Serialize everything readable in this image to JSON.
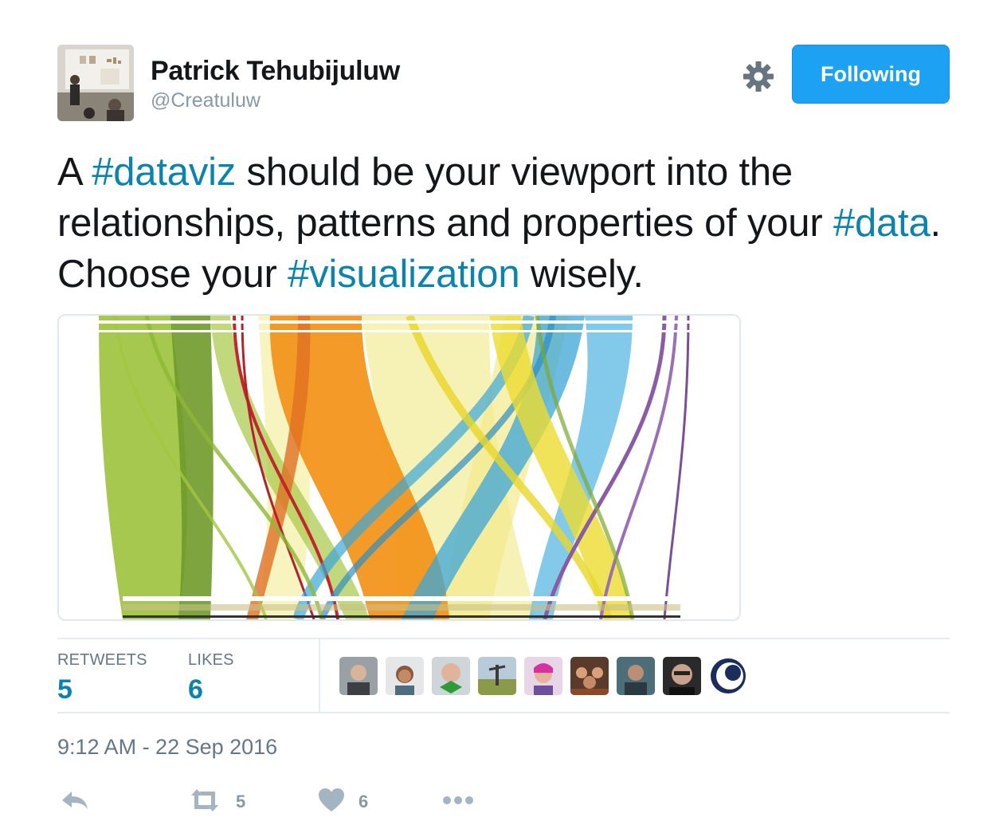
{
  "user": {
    "name": "Patrick Tehubijuluw",
    "handle": "@Creatuluw"
  },
  "header": {
    "follow_label": "Following",
    "settings_icon": "gear-icon"
  },
  "tweet": {
    "text_parts": {
      "p1": "A ",
      "h1": "#dataviz",
      "p2": " should be your viewport into the relationships, patterns and properties of your ",
      "h2": "#data",
      "p3": ". Choose your ",
      "h3": "#visualization",
      "p4": " wisely."
    }
  },
  "stats": {
    "retweets_label": "RETWEETS",
    "retweets_value": "5",
    "likes_label": "LIKES",
    "likes_value": "6"
  },
  "timestamp": "9:12 AM - 22 Sep 2016",
  "actions": {
    "reply_icon": "reply-icon",
    "retweet_icon": "retweet-icon",
    "retweet_count": "5",
    "like_icon": "heart-icon",
    "like_count": "6",
    "more_icon": "more-icon"
  },
  "colors": {
    "accent": "#1da1f2",
    "hashtag": "#0b84ad",
    "muted": "#657786"
  }
}
